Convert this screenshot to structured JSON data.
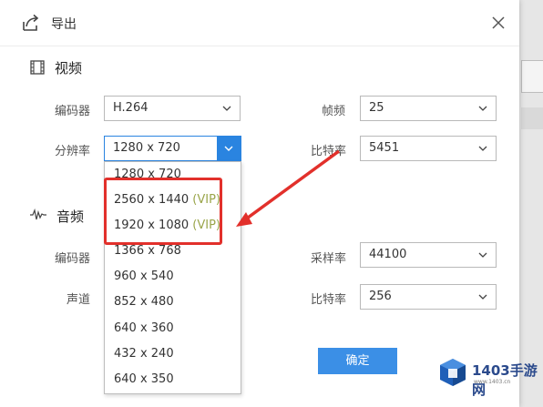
{
  "dialog": {
    "title": "导出",
    "close_icon": "close-icon",
    "export_icon": "export-share-icon"
  },
  "video": {
    "section_title": "视频",
    "section_icon": "film-icon",
    "encoder_label": "编码器",
    "encoder_value": "H.264",
    "framerate_label": "帧频",
    "framerate_value": "25",
    "resolution_label": "分辨率",
    "resolution_value": "1280 x 720",
    "bitrate_label": "比特率",
    "bitrate_value": "5451"
  },
  "audio": {
    "section_title": "音频",
    "section_icon": "waveform-icon",
    "encoder_label": "编码器",
    "samplerate_label": "采样率",
    "samplerate_value": "44100",
    "channel_label": "声道",
    "bitrate_label": "比特率",
    "bitrate_value": "256"
  },
  "resolution_options": [
    {
      "text": "1280 x 720",
      "vip": ""
    },
    {
      "text": "2560 x 1440 ",
      "vip": "(VIP)"
    },
    {
      "text": "1920 x 1080 ",
      "vip": "(VIP)"
    },
    {
      "text": "1366 x 768",
      "vip": ""
    },
    {
      "text": "960 x 540",
      "vip": ""
    },
    {
      "text": "852 x 480",
      "vip": ""
    },
    {
      "text": "640 x 360",
      "vip": ""
    },
    {
      "text": "432 x 240",
      "vip": ""
    },
    {
      "text": "640 x 350",
      "vip": ""
    }
  ],
  "ok_label": "确定",
  "watermark": {
    "text": "1403手游网",
    "sub": "www.1403.cn"
  },
  "colors": {
    "accent": "#2a84e0",
    "highlight": "#e2302b",
    "vip": "#9aa54a"
  }
}
